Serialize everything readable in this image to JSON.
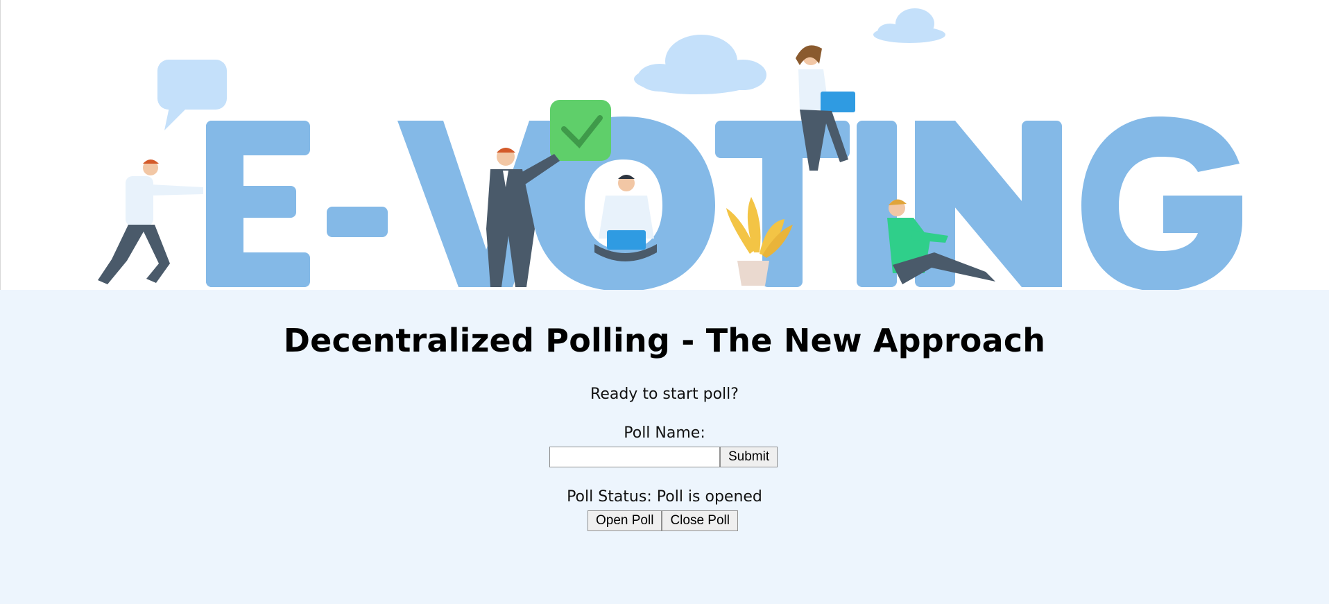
{
  "banner": {
    "word": "E-VOTING",
    "colors": {
      "letters": "#84b9e7",
      "cloud": "#c4e0fa",
      "check": "#5fcf6a",
      "suit": "#4a5a6a",
      "laptop": "#2f9be2",
      "plant": "#f3c445",
      "sweater": "#2fcf8a"
    }
  },
  "header": {
    "title": "Decentralized Polling - The New Approach"
  },
  "poll": {
    "prompt": "Ready to start poll?",
    "name_label": "Poll Name:",
    "name_value": "",
    "submit_label": "Submit",
    "status_label": "Poll Status:",
    "status_value": "Poll is opened",
    "open_label": "Open Poll",
    "close_label": "Close Poll"
  }
}
